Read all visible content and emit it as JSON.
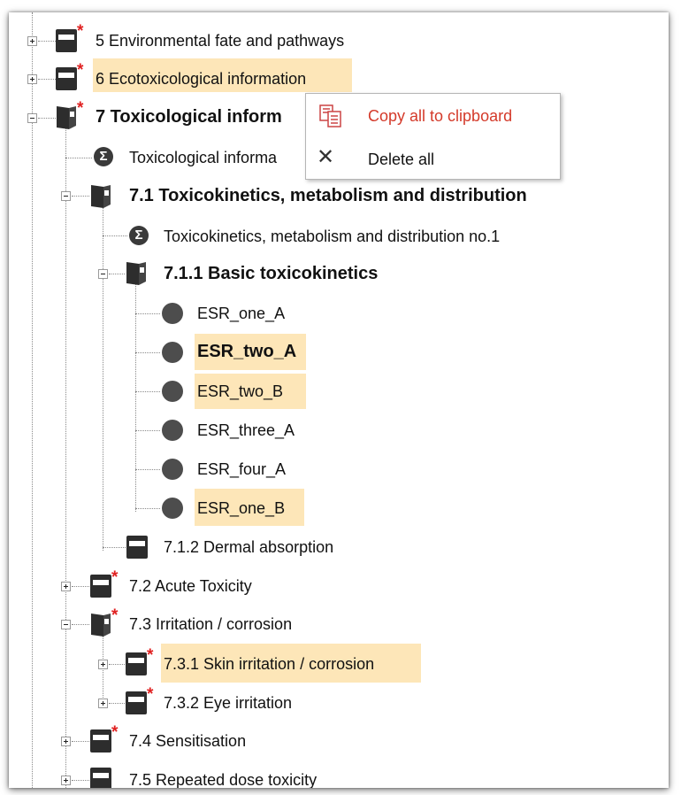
{
  "context_menu": {
    "copy_label": "Copy all to clipboard",
    "delete_label": "Delete all",
    "copy_color": "#d43a2a"
  },
  "tree": {
    "n5": "5 Environmental fate and pathways",
    "n6": "6 Ecotoxicological information",
    "n7": "7 Toxicological inform",
    "n7_summary": "Toxicological informa",
    "n7_1": "7.1 Toxicokinetics, metabolism and distribution",
    "n7_1_summary": "Toxicokinetics, metabolism and distribution no.1",
    "n7_1_1": "7.1.1 Basic toxicokinetics",
    "esr": [
      "ESR_one_A",
      "ESR_two_A",
      "ESR_two_B",
      "ESR_three_A",
      "ESR_four_A",
      "ESR_one_B"
    ],
    "n7_1_2": "7.1.2 Dermal absorption",
    "n7_2": "7.2 Acute Toxicity",
    "n7_3": "7.3 Irritation / corrosion",
    "n7_3_1": "7.3.1 Skin irritation / corrosion",
    "n7_3_2": "7.3.2 Eye irritation",
    "n7_4": "7.4 Sensitisation",
    "n7_5": "7.5 Repeated dose toxicity"
  },
  "icons": {
    "sigma_glyph": "Σ",
    "star_glyph": "*",
    "close_glyph": "✕"
  },
  "colors": {
    "highlight": "#fde6b8",
    "required_star": "#e02020"
  }
}
